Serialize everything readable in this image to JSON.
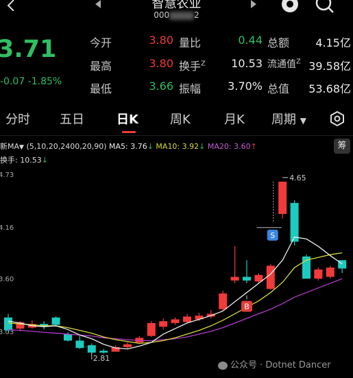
{
  "header": {
    "back_icon": "chevron-left-icon",
    "prev_icon": "triangle-left-icon",
    "next_icon": "triangle-right-icon",
    "title": "智慧农业",
    "subcode": "000",
    "subcode_suffix": "2"
  },
  "quote": {
    "price": "3.71",
    "change": "-0.07",
    "change_pct": "-1.85%",
    "col1": [
      {
        "label": "今开",
        "value": "3.80"
      },
      {
        "label": "最高",
        "value": "3.80"
      },
      {
        "label": "最低",
        "value": "3.66"
      }
    ],
    "col2": [
      {
        "label": "量比",
        "value": "0.44"
      },
      {
        "label": "换手",
        "sup": "Z",
        "value": "10.53"
      },
      {
        "label": "振幅",
        "value": "3.70%"
      }
    ],
    "col3": [
      {
        "label": "总额",
        "value": "4.15亿"
      },
      {
        "label": "流通值",
        "sup": "Z",
        "value": "39.58亿"
      },
      {
        "label": "总值",
        "value": "53.68亿"
      }
    ]
  },
  "tabs": [
    "分时",
    "五日",
    "日K",
    "周K",
    "月K",
    "周期"
  ],
  "indicators": {
    "ma_name": "新MA",
    "params": "(5,10,20,2400,20,90)",
    "ma5": "MA5: 3.76",
    "ma10": "MA10: 3.92",
    "ma20": "MA20: 3.60",
    "turnover": "换手: 10.53",
    "arrow_down": "↓",
    "arrow_up": "↑",
    "chip_button": "筹"
  },
  "colors": {
    "up": "#f23a3a",
    "down": "#1ccbbf",
    "ma5": "#eeeeee",
    "ma10": "#d9d93a",
    "ma20": "#b43ccf"
  },
  "chart_data": {
    "type": "candlestick",
    "price_labels": [
      "4.73",
      "4.16",
      "3.60",
      "3.03"
    ],
    "annotations": {
      "high": "4.65",
      "low": "2.81",
      "sell_marker": "S",
      "buy_marker": "B"
    },
    "candles": [
      {
        "o": 3.18,
        "c": 3.04,
        "h": 3.22,
        "l": 3.02
      },
      {
        "o": 3.06,
        "c": 3.13,
        "h": 3.14,
        "l": 3.03
      },
      {
        "o": 3.07,
        "c": 3.11,
        "h": 3.15,
        "l": 3.06
      },
      {
        "o": 3.11,
        "c": 3.08,
        "h": 3.14,
        "l": 3.05
      },
      {
        "o": 3.18,
        "c": 3.1,
        "h": 3.19,
        "l": 3.08
      },
      {
        "o": 3.0,
        "c": 2.93,
        "h": 3.02,
        "l": 2.92
      },
      {
        "o": 2.93,
        "c": 2.85,
        "h": 2.98,
        "l": 2.84
      },
      {
        "o": 2.88,
        "c": 2.8,
        "h": 2.9,
        "l": 2.79
      },
      {
        "o": 2.82,
        "c": 2.8,
        "h": 2.84,
        "l": 2.79
      },
      {
        "o": 2.81,
        "c": 2.86,
        "h": 2.88,
        "l": 2.81
      },
      {
        "o": 2.86,
        "c": 2.89,
        "h": 2.91,
        "l": 2.84
      },
      {
        "o": 2.91,
        "c": 2.96,
        "h": 2.98,
        "l": 2.9
      },
      {
        "o": 2.98,
        "c": 3.12,
        "h": 3.14,
        "l": 2.97
      },
      {
        "o": 3.08,
        "c": 3.14,
        "h": 3.17,
        "l": 3.05
      },
      {
        "o": 3.12,
        "c": 3.16,
        "h": 3.18,
        "l": 3.1
      },
      {
        "o": 3.13,
        "c": 3.19,
        "h": 3.22,
        "l": 3.12
      },
      {
        "o": 3.16,
        "c": 3.2,
        "h": 3.23,
        "l": 3.14
      },
      {
        "o": 3.19,
        "c": 3.22,
        "h": 3.26,
        "l": 3.17
      },
      {
        "o": 3.27,
        "c": 3.44,
        "h": 3.47,
        "l": 3.25
      },
      {
        "o": 3.58,
        "c": 3.62,
        "h": 3.95,
        "l": 3.55
      },
      {
        "o": 3.62,
        "c": 3.58,
        "h": 3.8,
        "l": 3.55
      },
      {
        "o": 3.57,
        "c": 3.64,
        "h": 3.66,
        "l": 3.55
      },
      {
        "o": 3.49,
        "c": 3.74,
        "h": 3.76,
        "l": 3.48
      },
      {
        "o": 4.3,
        "c": 4.65,
        "h": 4.65,
        "l": 4.25
      },
      {
        "o": 4.42,
        "c": 4.0,
        "h": 4.45,
        "l": 3.96
      },
      {
        "o": 3.84,
        "c": 3.6,
        "h": 3.86,
        "l": 3.6
      },
      {
        "o": 3.6,
        "c": 3.7,
        "h": 3.72,
        "l": 3.58
      },
      {
        "o": 3.62,
        "c": 3.72,
        "h": 3.74,
        "l": 3.6
      },
      {
        "o": 3.8,
        "c": 3.71,
        "h": 3.8,
        "l": 3.66
      }
    ],
    "ma5": [
      3.14,
      3.12,
      3.09,
      3.08,
      3.09,
      3.05,
      2.99,
      2.95,
      2.89,
      2.85,
      2.84,
      2.87,
      2.91,
      3.0,
      3.06,
      3.12,
      3.16,
      3.2,
      3.25,
      3.35,
      3.45,
      3.55,
      3.65,
      3.8,
      4.05,
      4.03,
      3.95,
      3.85,
      3.76
    ],
    "ma10": [
      3.12,
      3.11,
      3.1,
      3.09,
      3.09,
      3.07,
      3.04,
      3.01,
      2.97,
      2.94,
      2.92,
      2.9,
      2.91,
      2.93,
      2.96,
      3.0,
      3.04,
      3.09,
      3.15,
      3.22,
      3.29,
      3.36,
      3.45,
      3.56,
      3.72,
      3.8,
      3.83,
      3.86,
      3.88
    ],
    "ma20": [
      3.05,
      3.04,
      3.03,
      3.02,
      3.01,
      3.0,
      2.99,
      2.98,
      2.96,
      2.95,
      2.94,
      2.93,
      2.93,
      2.94,
      2.95,
      2.97,
      3.0,
      3.03,
      3.07,
      3.12,
      3.17,
      3.22,
      3.27,
      3.33,
      3.4,
      3.45,
      3.5,
      3.55,
      3.6
    ]
  },
  "watermark": "公众号 · Dotnet Dancer"
}
